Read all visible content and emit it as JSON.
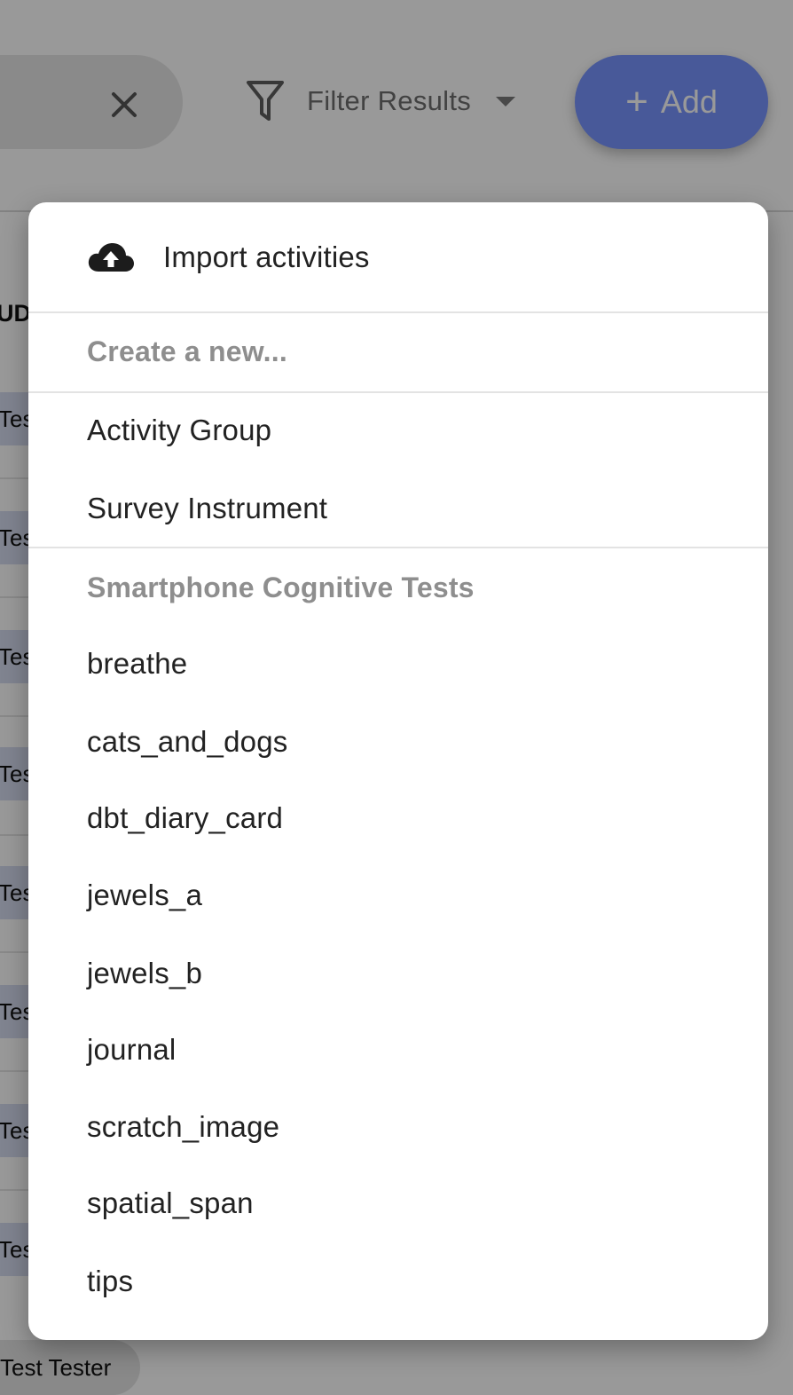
{
  "toolbar": {
    "filter_label": "Filter Results",
    "add_label": "Add",
    "add_color": "#7995ff"
  },
  "table": {
    "header_fragment": "UD",
    "row_chip_text": "Tes",
    "bottom_chip_text": "Test Tester"
  },
  "menu": {
    "import_label": "Import activities",
    "create_header": "Create a new...",
    "create_items": [
      "Activity Group",
      "Survey Instrument"
    ],
    "tests_header": "Smartphone Cognitive Tests",
    "test_items": [
      "breathe",
      "cats_and_dogs",
      "dbt_diary_card",
      "jewels_a",
      "jewels_b",
      "journal",
      "scratch_image",
      "spatial_span",
      "tips"
    ]
  },
  "icons": {
    "clear": "close-icon",
    "filter": "funnel-icon",
    "filter_caret": "chevron-down-icon",
    "add": "plus-icon",
    "import": "cloud-upload-icon"
  }
}
